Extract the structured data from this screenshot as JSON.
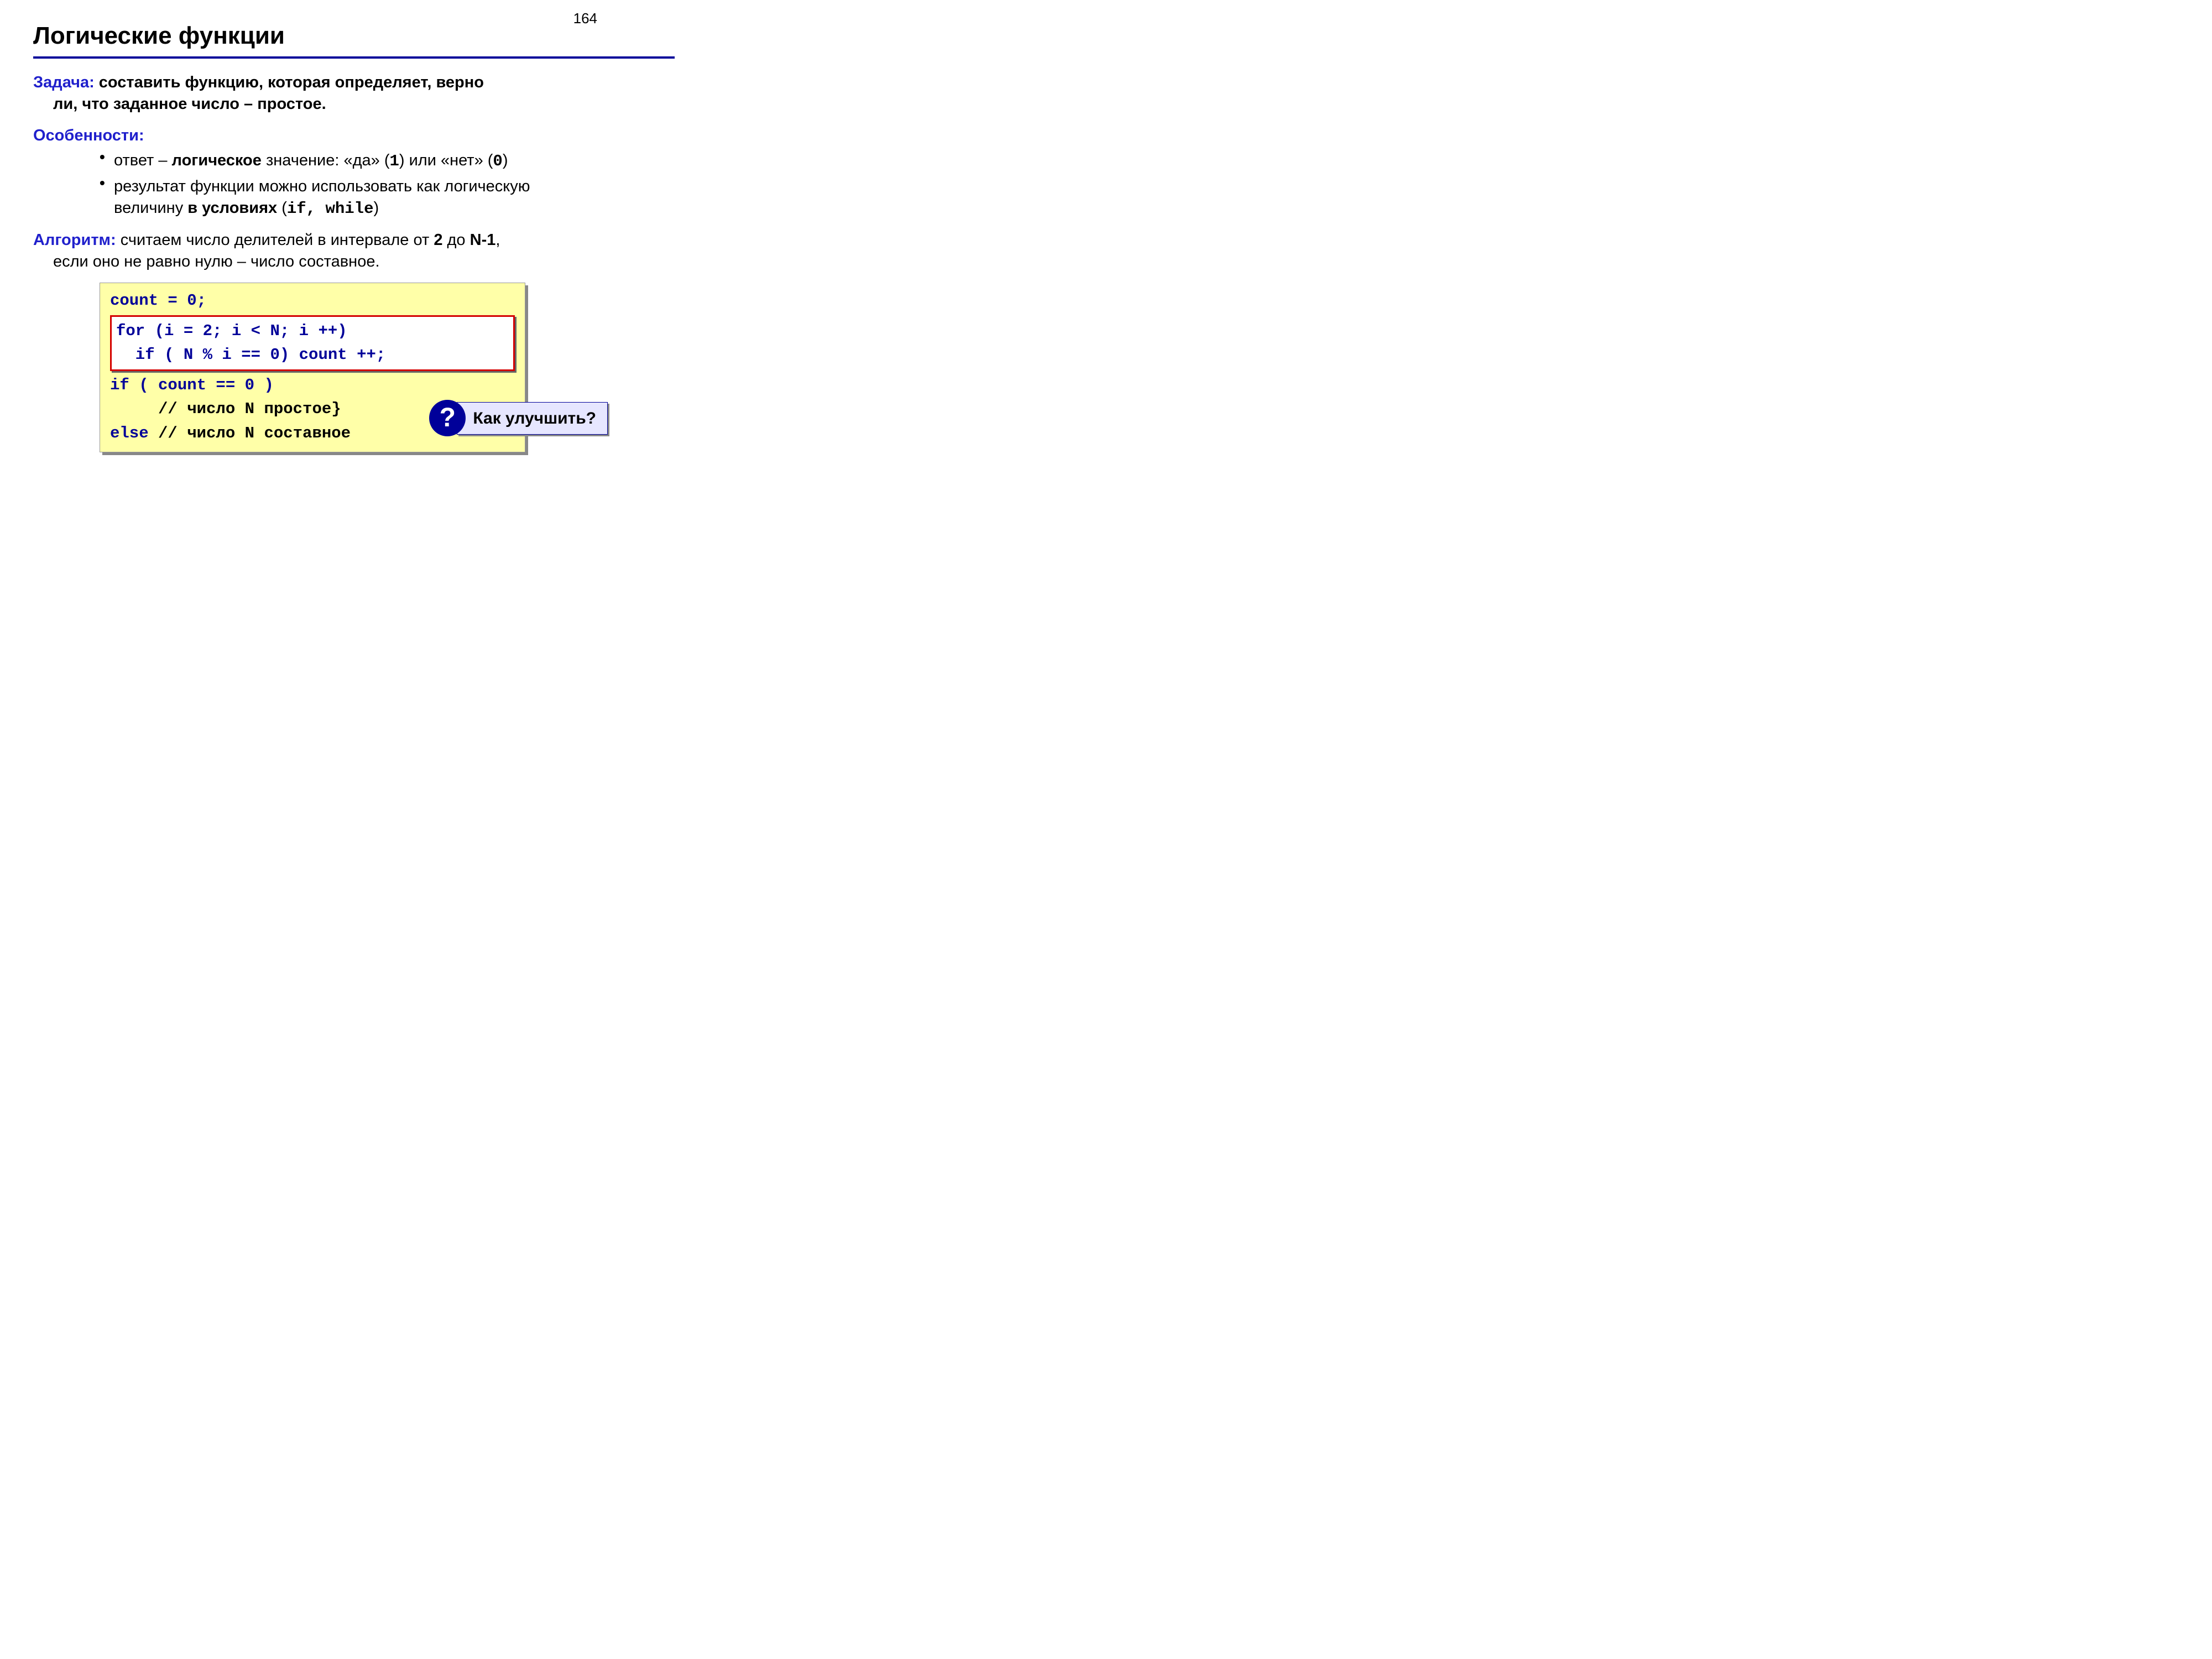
{
  "page_number": "164",
  "title": "Логические функции",
  "task": {
    "label": "Задача:",
    "line1_rest": " составить функцию, которая определяет, верно",
    "line2": "ли, что заданное число – простое."
  },
  "features": {
    "label": "Особенности:",
    "items": [
      {
        "pre": "ответ – ",
        "bold": "логическое",
        "post": " значение: «да» (",
        "mono1": "1",
        "mid": ") или «нет» (",
        "mono2": "0",
        "end": ")"
      },
      {
        "line1": "результат функции можно использовать как логическую",
        "line2_pre": "величину ",
        "line2_bold": "в условиях",
        "line2_open": " (",
        "line2_mono": "if,  while",
        "line2_close": ")"
      }
    ]
  },
  "algorithm": {
    "label": "Алгоритм:",
    "line1_rest": " считаем число делителей в интервале от ",
    "bold2": "2",
    "mid": " до ",
    "boldN1": "N-1",
    "comma": ",",
    "line2": "если оно не равно нулю – число составное."
  },
  "code": {
    "l1": "count = 0;",
    "h1": "for (i = 2; i < N; i ++)",
    "h2": "  if ( N % i == 0) count ++;",
    "l3": "if ( count == 0 )",
    "l4_pad": "     ",
    "l4_comment": "// число N простое}",
    "l5_else": "else ",
    "l5_comment": "// число N составное"
  },
  "callout": {
    "badge": "?",
    "text": "Как улучшить?"
  }
}
